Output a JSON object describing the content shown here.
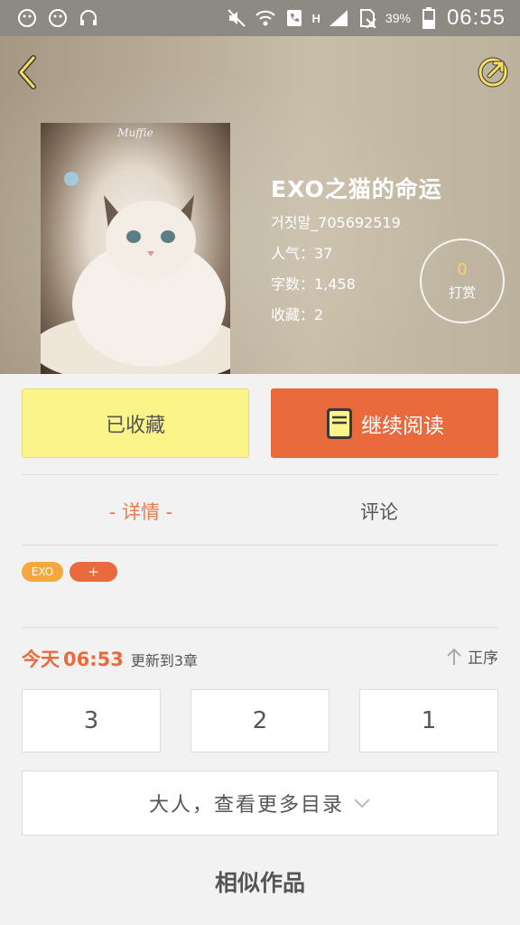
{
  "status_bar": {
    "network": "H",
    "battery": "39%",
    "time": "06:55"
  },
  "book": {
    "title": "EXO之猫的命运",
    "author": "거짓말_705692519",
    "popularity": "人气：37",
    "word_count": "字数：1,458",
    "favorites": "收藏：2",
    "cover_brand": "Muffie"
  },
  "tip": {
    "count": "0",
    "label": "打赏"
  },
  "actions": {
    "favorite": "已收藏",
    "read": "继续阅读"
  },
  "tabs": {
    "detail": "- 详情 -",
    "comment": "评论"
  },
  "tags": {
    "exo": "EXO",
    "add": "+"
  },
  "update": {
    "day": "今天",
    "time": "06:53",
    "text": "更新到3章",
    "order": "正序"
  },
  "chapters": [
    "3",
    "2",
    "1"
  ],
  "more_catalog": "大人，查看更多目录",
  "similar_works": "相似作品",
  "colors": {
    "accent": "#e86a3d",
    "favorite_bg": "#fbf489",
    "tag": "#f5a83d"
  }
}
